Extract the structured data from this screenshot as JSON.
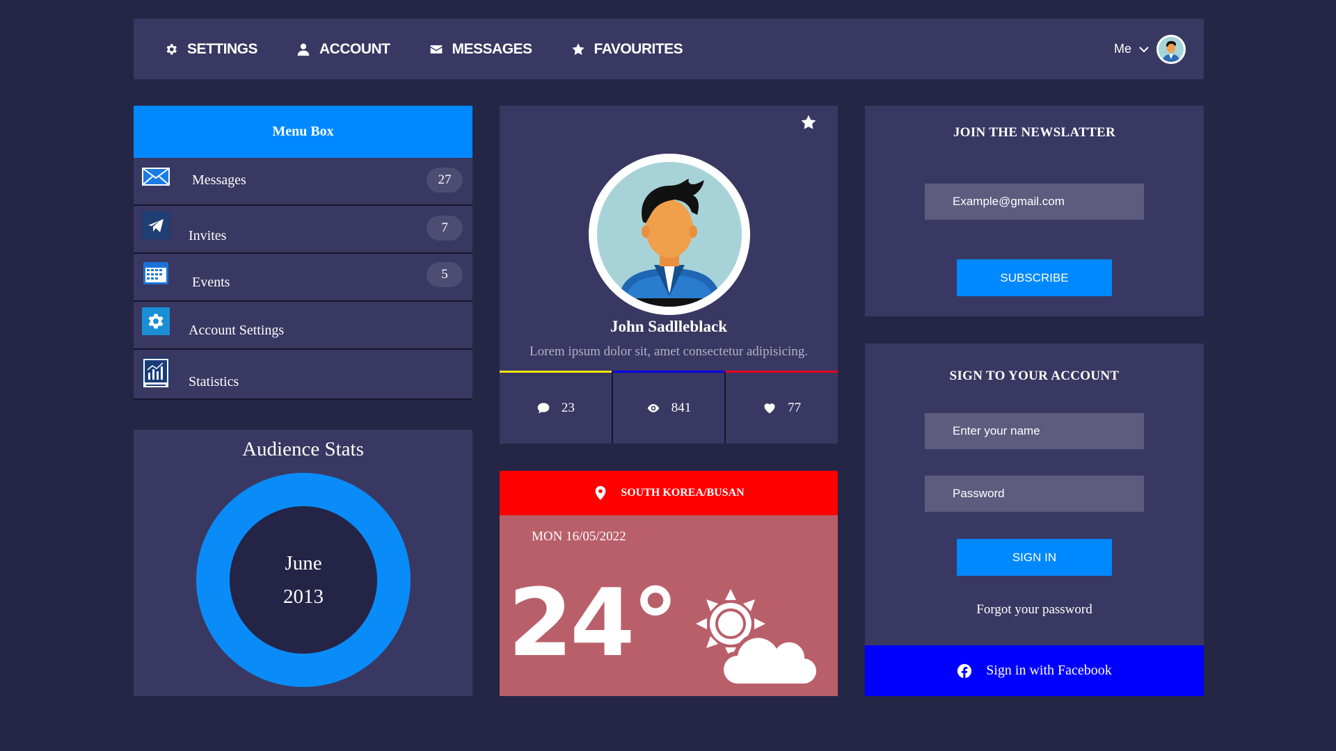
{
  "nav": {
    "items": [
      {
        "label": "SETTINGS",
        "icon": "gear-icon"
      },
      {
        "label": "ACCOUNT",
        "icon": "user-icon"
      },
      {
        "label": "MESSAGES",
        "icon": "envelope-icon"
      },
      {
        "label": "FAVOURITES",
        "icon": "star-icon"
      }
    ],
    "user_label": "Me"
  },
  "menu_box": {
    "title": "Menu Box",
    "items": [
      {
        "label": "Messages",
        "count": "27",
        "icon": "mail-icon"
      },
      {
        "label": "Invites",
        "count": "7",
        "icon": "send-icon"
      },
      {
        "label": "Events",
        "count": "5",
        "icon": "calendar-icon"
      },
      {
        "label": "Account Settings",
        "icon": "settings-icon"
      },
      {
        "label": "Statistics",
        "icon": "data-analysis-icon"
      }
    ]
  },
  "audience": {
    "title": "Audience Stats",
    "month": "June",
    "year": "2013"
  },
  "profile": {
    "name": "John Sadlleblack",
    "description": "Lorem ipsum dolor sit, amet consectetur adipisicing.",
    "stats": [
      {
        "value": "23",
        "icon": "comment-icon",
        "color": "#f5e800"
      },
      {
        "value": "841",
        "icon": "eye-icon",
        "color": "#0a00e8"
      },
      {
        "value": "77",
        "icon": "heart-icon",
        "color": "#e8001c"
      }
    ]
  },
  "weather": {
    "location": "SOUTH KOREA/BUSAN",
    "date": "MON 16/05/2022",
    "temperature": "24°",
    "icon": "partly-cloudy-icon"
  },
  "newsletter": {
    "title": "JOIN THE NEWSLATTER",
    "email_placeholder": "Example@gmail.com",
    "subscribe_label": "SUBSCRIBE"
  },
  "signin": {
    "title": "SIGN TO YOUR ACCOUNT",
    "name_placeholder": "Enter your name",
    "password_placeholder": "Password",
    "signin_label": "SIGN IN",
    "forgot_label": "Forgot your password",
    "facebook_label": "Sign in with Facebook"
  },
  "colors": {
    "background": "#252546",
    "panel": "#393862",
    "accent_blue": "#0088ff",
    "facebook_blue": "#0000ff",
    "weather_red": "#ff0000",
    "weather_body": "#b95f6a"
  }
}
